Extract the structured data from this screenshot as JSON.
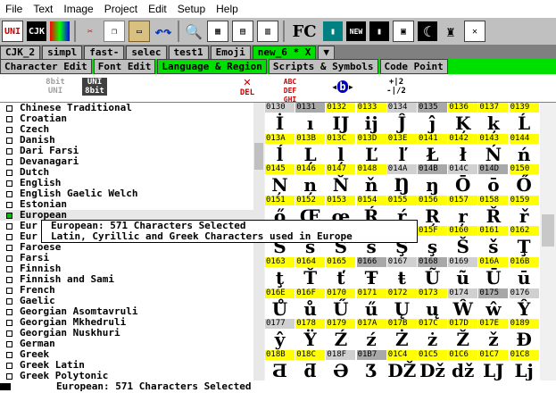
{
  "menu": [
    "File",
    "Text",
    "Image",
    "Project",
    "Edit",
    "Setup",
    "Help"
  ],
  "toolbar": {
    "fc_label": "FC"
  },
  "file_tabs": [
    "CJK_2",
    "simpl",
    "fast-",
    "selec",
    "test1",
    "Emoji",
    "new_6 * X"
  ],
  "main_tabs": [
    "Character Edit",
    "Font Edit",
    "Language & Region",
    "Scripts & Symbols",
    "Code Point"
  ],
  "sub_toolbar": {
    "bit8_uni": "8bit\nUNI",
    "uni_8bit": "UNI\n8bit",
    "del": "DEL",
    "abc": "ABC\nDEF\nGHI",
    "frac": "+|2\n-|/2"
  },
  "languages": [
    {
      "name": "Chinese Traditional",
      "checked": false
    },
    {
      "name": "Croatian",
      "checked": false
    },
    {
      "name": "Czech",
      "checked": false
    },
    {
      "name": "Danish",
      "checked": false
    },
    {
      "name": "Dari Farsi",
      "checked": false
    },
    {
      "name": "Devanagari",
      "checked": false
    },
    {
      "name": "Dutch",
      "checked": false
    },
    {
      "name": "English",
      "checked": false
    },
    {
      "name": "English Gaelic Welch",
      "checked": false
    },
    {
      "name": "Estonian",
      "checked": false
    },
    {
      "name": "European",
      "checked": true
    },
    {
      "name": "Eur",
      "checked": false
    },
    {
      "name": "Eur",
      "checked": false
    },
    {
      "name": "Faroese",
      "checked": false
    },
    {
      "name": "Farsi",
      "checked": false
    },
    {
      "name": "Finnish",
      "checked": false
    },
    {
      "name": "Finnish and Sami",
      "checked": false
    },
    {
      "name": "French",
      "checked": false
    },
    {
      "name": "Gaelic",
      "checked": false
    },
    {
      "name": "Georgian Asomtavruli",
      "checked": false
    },
    {
      "name": "Georgian Mkhedruli",
      "checked": false
    },
    {
      "name": "Georgian Nuskhuri",
      "checked": false
    },
    {
      "name": "German",
      "checked": false
    },
    {
      "name": "Greek",
      "checked": false
    },
    {
      "name": "Greek Latin",
      "checked": false
    },
    {
      "name": "Greek Polytonic",
      "checked": false
    }
  ],
  "tooltip": {
    "line1": "European: 571 Characters Selected",
    "line2": "Latin, Cyrillic and Greek Characters used in Europe"
  },
  "grid": [
    [
      [
        "0130",
        "İ",
        0
      ],
      [
        "0131",
        "ı",
        0
      ],
      [
        "0132",
        "Ĳ",
        1
      ],
      [
        "0133",
        "ĳ",
        1
      ],
      [
        "0134",
        "Ĵ",
        0
      ],
      [
        "0135",
        "ĵ",
        0
      ],
      [
        "0136",
        "Ķ",
        1
      ],
      [
        "0137",
        "ķ",
        1
      ],
      [
        "0139",
        "Ĺ",
        1
      ]
    ],
    [
      [
        "013A",
        "ĺ",
        1
      ],
      [
        "013B",
        "Ļ",
        1
      ],
      [
        "013C",
        "ļ",
        1
      ],
      [
        "013D",
        "Ľ",
        1
      ],
      [
        "013E",
        "ľ",
        1
      ],
      [
        "0141",
        "Ł",
        1
      ],
      [
        "0142",
        "ł",
        1
      ],
      [
        "0143",
        "Ń",
        1
      ],
      [
        "0144",
        "ń",
        1
      ]
    ],
    [
      [
        "0145",
        "Ņ",
        1
      ],
      [
        "0146",
        "ņ",
        1
      ],
      [
        "0147",
        "Ň",
        1
      ],
      [
        "0148",
        "ň",
        1
      ],
      [
        "014A",
        "Ŋ",
        0
      ],
      [
        "014B",
        "ŋ",
        0
      ],
      [
        "014C",
        "Ō",
        0
      ],
      [
        "014D",
        "ō",
        0
      ],
      [
        "0150",
        "Ő",
        1
      ]
    ],
    [
      [
        "0151",
        "ő",
        1
      ],
      [
        "0152",
        "Œ",
        1
      ],
      [
        "0153",
        "œ",
        1
      ],
      [
        "0154",
        "Ŕ",
        1
      ],
      [
        "0155",
        "ŕ",
        1
      ],
      [
        "0156",
        "Ŗ",
        1
      ],
      [
        "0157",
        "ŗ",
        1
      ],
      [
        "0158",
        "Ř",
        1
      ],
      [
        "0159",
        "ř",
        1
      ]
    ],
    [
      [
        "015A",
        "Ś",
        0
      ],
      [
        "015B",
        "ś",
        0
      ],
      [
        "015C",
        "Ŝ",
        0
      ],
      [
        "015D",
        "ŝ",
        0
      ],
      [
        "015E",
        "Ş",
        0
      ],
      [
        "015F",
        "ş",
        1
      ],
      [
        "0160",
        "Š",
        1
      ],
      [
        "0161",
        "š",
        1
      ],
      [
        "0162",
        "Ţ",
        1
      ]
    ],
    [
      [
        "0163",
        "ţ",
        1
      ],
      [
        "0164",
        "Ť",
        1
      ],
      [
        "0165",
        "ť",
        1
      ],
      [
        "0166",
        "Ŧ",
        0
      ],
      [
        "0167",
        "ŧ",
        0
      ],
      [
        "0168",
        "Ũ",
        0
      ],
      [
        "0169",
        "ũ",
        0
      ],
      [
        "016A",
        "Ū",
        1
      ],
      [
        "016B",
        "ū",
        1
      ]
    ],
    [
      [
        "016E",
        "Ů",
        1
      ],
      [
        "016F",
        "ů",
        1
      ],
      [
        "0170",
        "Ű",
        1
      ],
      [
        "0171",
        "ű",
        1
      ],
      [
        "0172",
        "Ų",
        1
      ],
      [
        "0173",
        "ų",
        1
      ],
      [
        "0174",
        "Ŵ",
        0
      ],
      [
        "0175",
        "ŵ",
        0
      ],
      [
        "0176",
        "Ŷ",
        0
      ]
    ],
    [
      [
        "0177",
        "ŷ",
        0
      ],
      [
        "0178",
        "Ÿ",
        1
      ],
      [
        "0179",
        "Ź",
        1
      ],
      [
        "017A",
        "ź",
        1
      ],
      [
        "017B",
        "Ż",
        1
      ],
      [
        "017C",
        "ż",
        1
      ],
      [
        "017D",
        "Ž",
        1
      ],
      [
        "017E",
        "ž",
        1
      ],
      [
        "0189",
        "Đ",
        1
      ]
    ],
    [
      [
        "018B",
        "Ƌ",
        1
      ],
      [
        "018C",
        "ƌ",
        1
      ],
      [
        "018F",
        "Ə",
        0
      ],
      [
        "01B7",
        "Ʒ",
        0
      ],
      [
        "01C4",
        "Ǆ",
        1
      ],
      [
        "01C5",
        "ǅ",
        1
      ],
      [
        "01C6",
        "ǆ",
        1
      ],
      [
        "01C7",
        "Ǉ",
        1
      ],
      [
        "01C8",
        "ǈ",
        1
      ]
    ]
  ],
  "status": "European: 571 Characters Selected",
  "colors": {
    "accent_green": "#00e000",
    "highlight_yellow": "#ffff00"
  }
}
